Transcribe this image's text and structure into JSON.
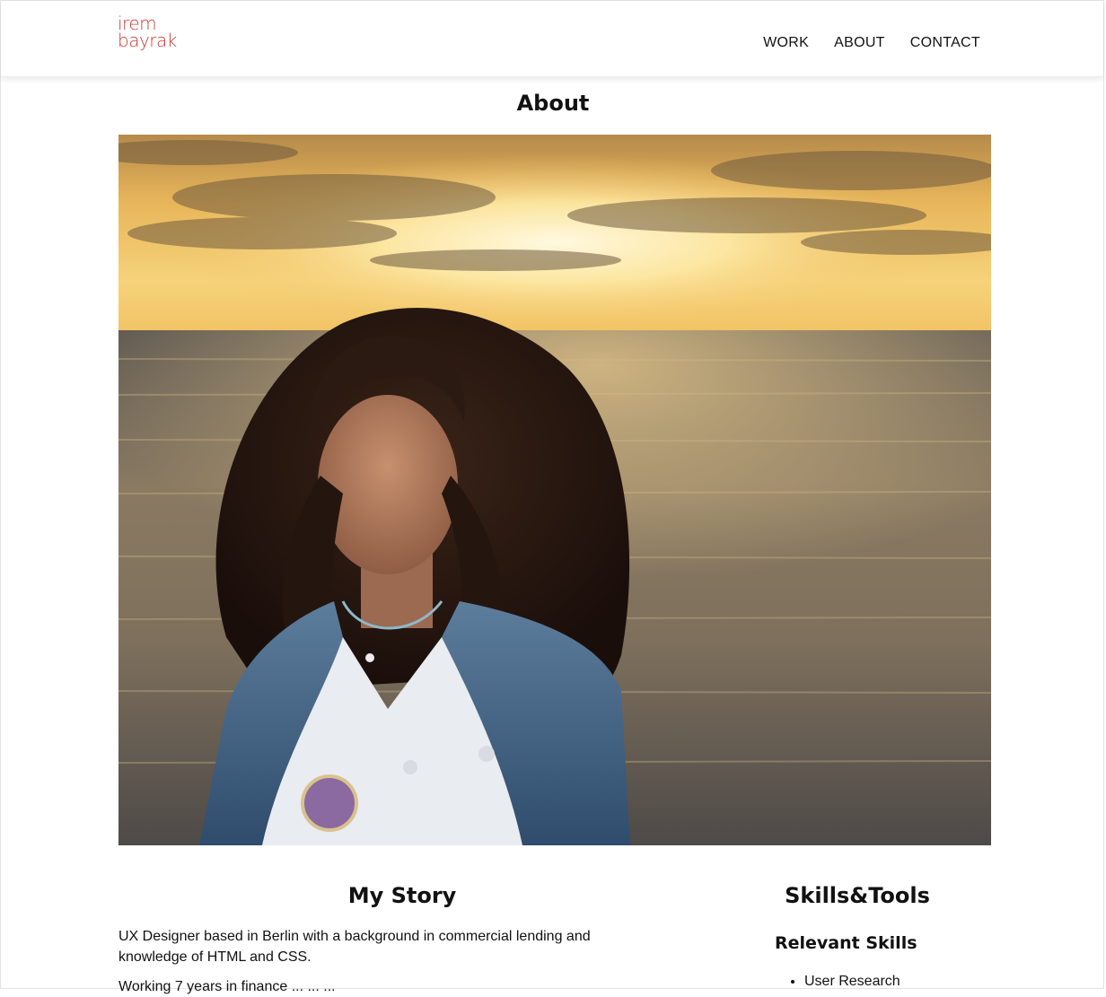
{
  "header": {
    "logo_line1": "irem",
    "logo_line2": "bayrak",
    "nav": [
      {
        "label": "WORK"
      },
      {
        "label": "ABOUT"
      },
      {
        "label": "CONTACT"
      }
    ]
  },
  "page": {
    "title": "About"
  },
  "hero": {
    "alt": "Portrait at the sea during sunset"
  },
  "story": {
    "title": "My Story",
    "paragraph1": "UX Designer based in Berlin with a background in commercial lending and knowledge of HTML and CSS.",
    "paragraph2": "Working 7 years in finance ... ... ..."
  },
  "skills": {
    "title": "Skills&Tools",
    "relevant_title": "Relevant Skills",
    "items": [
      "User Research"
    ]
  },
  "colors": {
    "logo": "#cc3b33",
    "text": "#111111",
    "background": "#ffffff"
  }
}
